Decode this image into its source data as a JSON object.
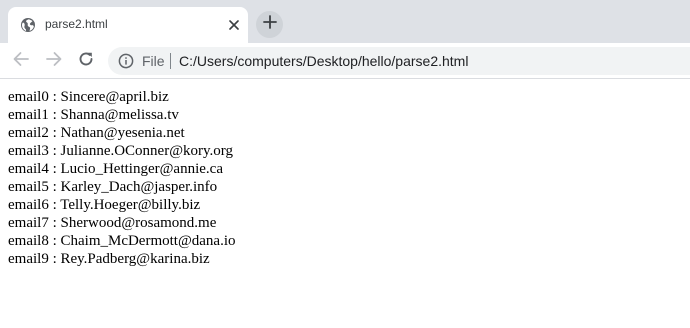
{
  "tab": {
    "title": "parse2.html",
    "favicon": "globe-icon",
    "close_icon": "close-icon"
  },
  "toolbar": {
    "back_icon": "arrow-back-icon",
    "forward_icon": "arrow-forward-icon",
    "reload_icon": "reload-icon",
    "new_tab_icon": "plus-icon"
  },
  "omnibox": {
    "info_icon": "info-icon",
    "scheme_label": "File",
    "url": "C:/Users/computers/Desktop/hello/parse2.html"
  },
  "content": {
    "lines": [
      "email0 : Sincere@april.biz",
      "email1 : Shanna@melissa.tv",
      "email2 : Nathan@yesenia.net",
      "email3 : Julianne.OConner@kory.org",
      "email4 : Lucio_Hettinger@annie.ca",
      "email5 : Karley_Dach@jasper.info",
      "email6 : Telly.Hoeger@billy.biz",
      "email7 : Sherwood@rosamond.me",
      "email8 : Chaim_McDermott@dana.io",
      "email9 : Rey.Padberg@karina.biz"
    ]
  },
  "colors": {
    "tabstrip_bg": "#dee1e6",
    "omnibox_bg": "#f1f3f4",
    "icon": "#5f6368",
    "text": "#000000"
  }
}
